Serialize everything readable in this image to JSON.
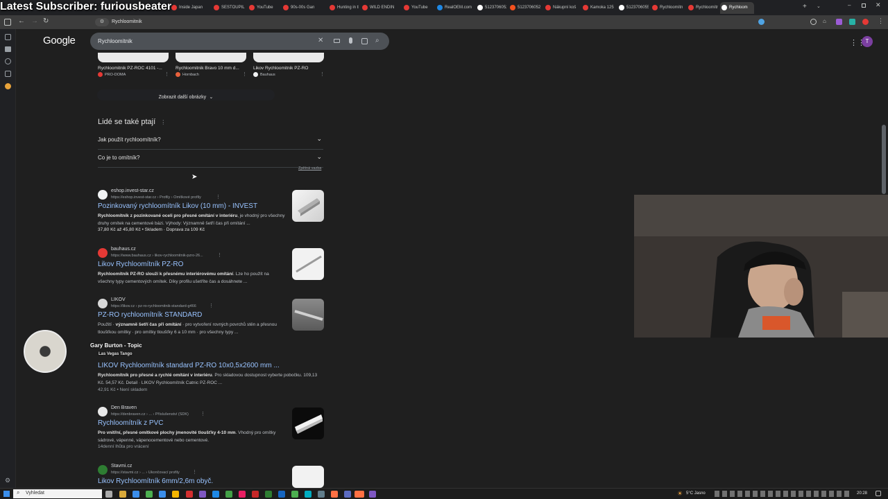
{
  "overlay": {
    "title": "Latest Subscriber: furiousbeater"
  },
  "tabs": [
    {
      "label": "Inside Japan",
      "color": "#e53935"
    },
    {
      "label": "SESTOUPIL Z",
      "color": "#e53935"
    },
    {
      "label": "YouTube",
      "color": "#e53935"
    },
    {
      "label": "90s-00s Gan",
      "color": "#e53935"
    },
    {
      "label": "Hunting in th",
      "color": "#e53935"
    },
    {
      "label": "WILD ENDIN",
      "color": "#e53935"
    },
    {
      "label": "YouTube",
      "color": "#e53935"
    },
    {
      "label": "RealOEM.com",
      "color": "#1e88e5"
    },
    {
      "label": "5123706052",
      "color": "#ffffff"
    },
    {
      "label": "5123706052",
      "color": "#f4511e"
    },
    {
      "label": "Nákupní koš",
      "color": "#e53935"
    },
    {
      "label": "Kamoka 125",
      "color": "#e53935"
    },
    {
      "label": "5123706055",
      "color": "#ffffff"
    },
    {
      "label": "Rychloomítn",
      "color": "#e53935"
    },
    {
      "label": "Rychloomítn",
      "color": "#e53935"
    },
    {
      "label": "Rychloom",
      "color": "#ffffff"
    }
  ],
  "addressbar": {
    "url": "Rychloomitnik"
  },
  "google": {
    "logo": "Google",
    "query": "Rychloomitnik",
    "avatar_letter": "T"
  },
  "image_row": [
    {
      "title": "Rychloomitnik PZ-ROC 4101 -...",
      "source": "PRO-DOMA"
    },
    {
      "title": "Rychloomitnik Bravo 10 mm d...",
      "source": "Hornbach"
    },
    {
      "title": "Likov Rychloomitnik PZ-RO",
      "source": "Bauhaus"
    }
  ],
  "more_images": "Zobrazit další obrázky",
  "paa": {
    "heading": "Lidé se také ptají",
    "questions": [
      "Jak použít rychloomítník?",
      "Co je to omítník?"
    ],
    "feedback": "Zpětná vazba"
  },
  "results": [
    {
      "site": "eshop.invest-star.cz",
      "url": "https://eshop.invest-star.cz › Profily › Omítkové profily",
      "title": "Pozinkovaný rychloomítník Likov (10 mm) - INVEST",
      "snippet_bold": "Rychloomítník z pozinkované oceli pro přesné omítání v interiéru",
      "snippet_rest": ", je vhodný pro všechny druhy omítek na cementové bázi. Výhody: Významně šetří čas při omítání ...",
      "meta": "37,80 Kč až 45,80 Kč  •  Skladem · Doprava za 109 Kč"
    },
    {
      "site": "bauhaus.cz",
      "url": "https://www.bauhaus.cz › likov-rychloomitnik-pzro-26...",
      "title": "Likov Rychloomítník PZ-RO",
      "snippet_bold": "Rychloomítník PZ-RO slouží k přesnému interiérovému omítání",
      "snippet_rest": ". Lze ho použít na všechny typy cementových omítek. Díky profilu ušetříte čas a dosáhnete ...",
      "meta": ""
    },
    {
      "site": "LIKOV",
      "url": "https://likov.cz › pz-ro-rychloomitnik-standard-g466",
      "title": "PZ-RO rychloomítník STANDARD",
      "snippet_bold": "významně šetří čas při omítání",
      "snippet_rest": " · pro vytvoření rovných povrchů stěn a přesnou tloušťkou omítky · pro omítky tloušťky 6 a 10 mm · pro všechny typy ...",
      "snippet_prefix": "Použití · ",
      "meta": ""
    },
    {
      "site": "",
      "url": "",
      "title": "LIKOV Rychloomítník standard PZ-RO 10x0,5x2600 mm ...",
      "snippet_bold": "Rychloomítník pro přesné a rychlé omítání v interiéru",
      "snippet_rest": ". Pro skladovou dostupnost vyberte pobočku. 109,13 Kč. 54,57 Kč. Detail · LIKOV Rychloomítník Catnic PZ-ROC ...",
      "meta": "42,91 Kč  •  Není skladem"
    },
    {
      "site": "Den Braven",
      "url": "https://denbraven.cz › ... › Příslušenství (SDK)",
      "title": "Rychloomítník z PVC",
      "snippet_bold": "Pro vnitřní, přesné omítkové plochy jmenovité tloušťky 4-10 mm",
      "snippet_rest": ". Vhodný pro omítky sádrové, vápenné, vápenocementové nebo cementové.",
      "meta": "14denní lhůta pro vrácení"
    },
    {
      "site": "Stavmi.cz",
      "url": "https://stavmi.cz › ... › Ukončovací profily",
      "title": "Likov Rychloomítník 6mm/2,6m obyč.",
      "snippet_bold": "",
      "snippet_rest": "",
      "meta": ""
    }
  ],
  "music_overlay": {
    "artist": "Gary Burton - Topic",
    "track": "Las Vegas Tango"
  },
  "taskbar": {
    "search_placeholder": "Vyhledat",
    "weather": "5°C  Jasno",
    "time": "20:28"
  }
}
